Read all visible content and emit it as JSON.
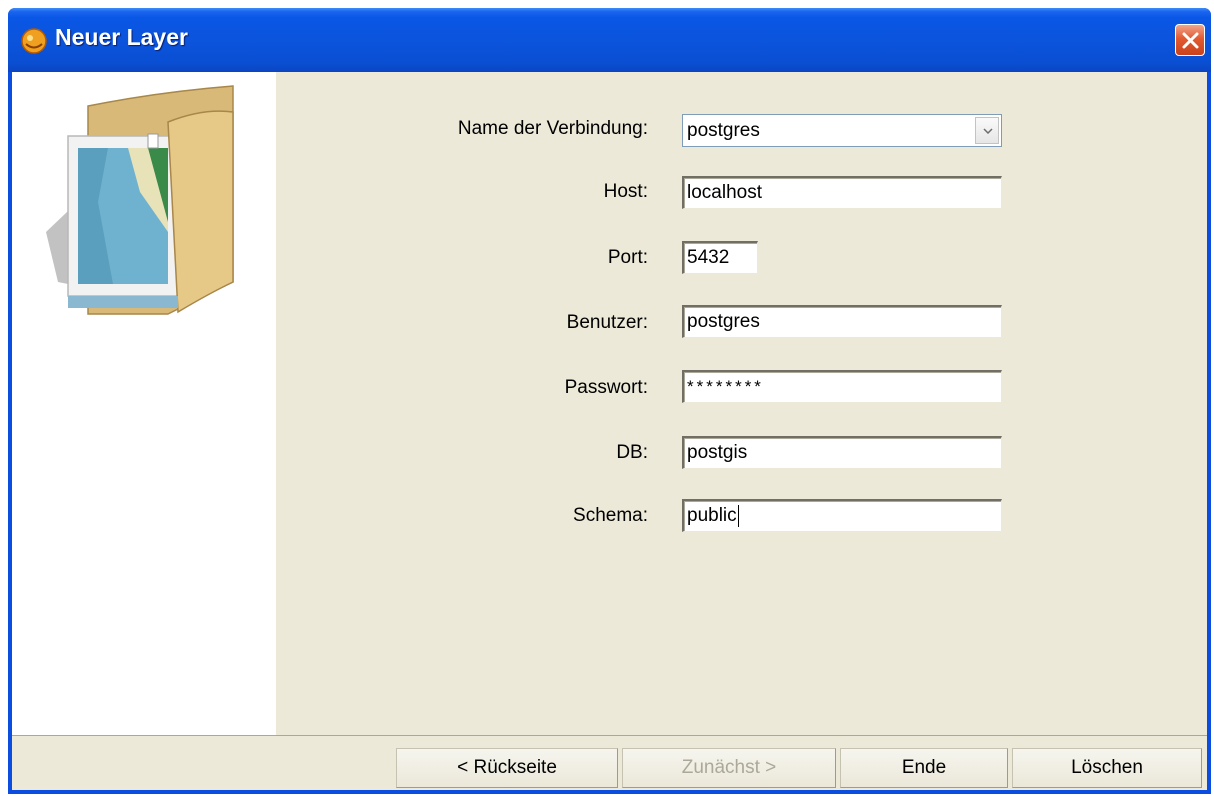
{
  "window": {
    "title": "Neuer Layer",
    "close_label": "×"
  },
  "form": {
    "connection_name_label": "Name der Verbindung:",
    "connection_name_value": "postgres",
    "host_label": "Host:",
    "host_value": "localhost",
    "port_label": "Port:",
    "port_value": "5432",
    "user_label": "Benutzer:",
    "user_value": "postgres",
    "password_label": "Passwort:",
    "password_value": "********",
    "db_label": "DB:",
    "db_value": "postgis",
    "schema_label": "Schema:",
    "schema_value": "public"
  },
  "buttons": {
    "back_label": "< Rückseite",
    "next_label": "Zunächst >",
    "finish_label": "Ende",
    "delete_label": "Löschen"
  },
  "icons": {
    "app": "app-icon",
    "close": "close-icon",
    "dropdown": "chevron-down-icon",
    "illustration": "folder-icon"
  },
  "colors": {
    "titlebar": "#0a54dc",
    "dialog_background": "#ece9d8",
    "close_button": "#e25a2f",
    "disabled_text": "#aca899"
  }
}
